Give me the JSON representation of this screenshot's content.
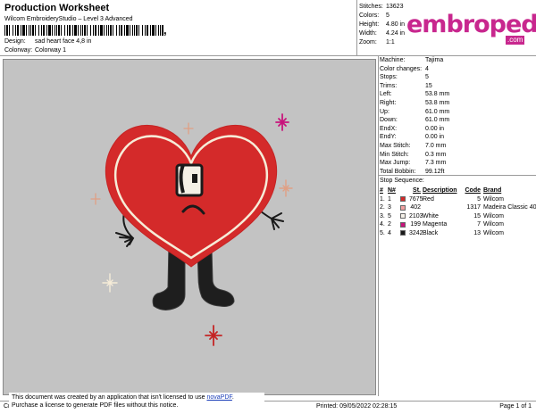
{
  "header": {
    "title": "Production Worksheet",
    "subtitle": "Wilcom EmbroideryStudio – Level 3 Advanced",
    "barcode_suffix": ",",
    "design_label": "Design:",
    "design_value": "sad heart face 4,8 in",
    "colorway_label": "Colorway:",
    "colorway_value": "Colorway 1"
  },
  "stats": [
    {
      "label": "Stitches:",
      "value": "13623"
    },
    {
      "label": "Colors:",
      "value": "5"
    },
    {
      "label": "Height:",
      "value": "4.80 in"
    },
    {
      "label": "Width:",
      "value": "4.24 in"
    },
    {
      "label": "Zoom:",
      "value": "1:1"
    }
  ],
  "logo": {
    "text": "embropedia",
    "suffix": ".com",
    "color": "#c8278e"
  },
  "machine": [
    {
      "label": "Machine:",
      "value": "Tajima"
    },
    {
      "label": "Color changes:",
      "value": "4"
    },
    {
      "label": "Stops:",
      "value": "5"
    },
    {
      "label": "Trims:",
      "value": "15"
    },
    {
      "label": "Left:",
      "value": "53.8 mm"
    },
    {
      "label": "Right:",
      "value": "53.8 mm"
    },
    {
      "label": "Up:",
      "value": "61.0 mm"
    },
    {
      "label": "Down:",
      "value": "61.0 mm"
    },
    {
      "label": "EndX:",
      "value": "0.00 in"
    },
    {
      "label": "EndY:",
      "value": "0.00 in"
    },
    {
      "label": "Max Stitch:",
      "value": "7.0 mm"
    },
    {
      "label": "Min Stitch:",
      "value": "0.3 mm"
    },
    {
      "label": "Max Jump:",
      "value": "7.3 mm"
    },
    {
      "label": "Total Bobbin:",
      "value": "99.12ft"
    }
  ],
  "stop_sequence": {
    "title": "Stop Sequence:",
    "headers": {
      "num": "#",
      "n": "N#",
      "st": "St.",
      "desc": "Description",
      "code": "Code",
      "brand": "Brand"
    },
    "rows": [
      {
        "num": "1.",
        "n": "1",
        "swatch": "#d42a2a",
        "st": "7675",
        "desc": "Red",
        "code": "5",
        "brand": "Wilcom"
      },
      {
        "num": "2.",
        "n": "3",
        "swatch": "#f0a0a0",
        "st": "402",
        "desc": "",
        "code": "1317",
        "brand": "Madeira Classic 40"
      },
      {
        "num": "3.",
        "n": "5",
        "swatch": "#f4f0e8",
        "st": "2103",
        "desc": "White",
        "code": "15",
        "brand": "Wilcom"
      },
      {
        "num": "4.",
        "n": "2",
        "swatch": "#c8147c",
        "st": "199",
        "desc": "Magenta",
        "code": "7",
        "brand": "Wilcom"
      },
      {
        "num": "5.",
        "n": "4",
        "swatch": "#1a1a1a",
        "st": "3242",
        "desc": "Black",
        "code": "13",
        "brand": "Wilcom"
      }
    ]
  },
  "footer": {
    "notice_line1": "This document was created by an application that isn't licensed to use ",
    "notice_link": "novaPDF",
    "notice_line1_end": ".",
    "notice_line2": "Purchase a license to generate PDF files without this notice.",
    "left_code": "Cr",
    "printed": "Printed: 09/05/2022 02:28:15",
    "page": "Page 1 of 1"
  },
  "colors": {
    "canvas_bg": "#c3c3c3",
    "heart_red": "#d42a2a",
    "sparkle_magenta": "#c8147c",
    "sparkle_peach": "#e0a084"
  }
}
